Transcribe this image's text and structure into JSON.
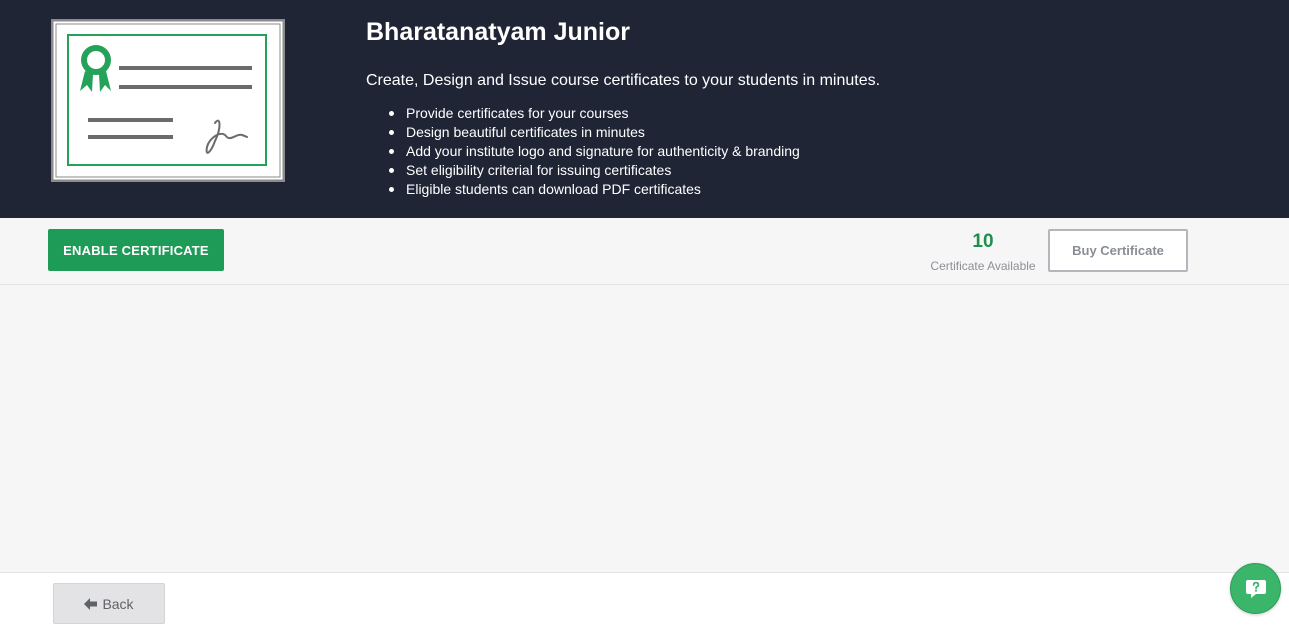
{
  "hero": {
    "title": "Bharatanatyam Junior",
    "subtitle": "Create, Design and Issue course certificates to your students in minutes.",
    "features": [
      "Provide certificates for your courses",
      "Design beautiful certificates in minutes",
      "Add your institute logo and signature for authenticity & branding",
      "Set eligibility criterial for issuing certificates",
      "Eligible students can download PDF certificates"
    ],
    "illustration_icon": "certificate-icon"
  },
  "actions": {
    "enable_label": "ENABLE CERTIFICATE",
    "available_count": "10",
    "available_label": "Certificate Available",
    "buy_label": "Buy Certificate"
  },
  "footer": {
    "back_label": "Back",
    "back_icon": "arrow-left-icon",
    "help_icon": "help-chat-icon"
  },
  "colors": {
    "hero_bg": "#1f2535",
    "accent_green": "#1d9b57",
    "count_green": "#1e8f4d",
    "panel_bg": "#f6f6f7"
  }
}
